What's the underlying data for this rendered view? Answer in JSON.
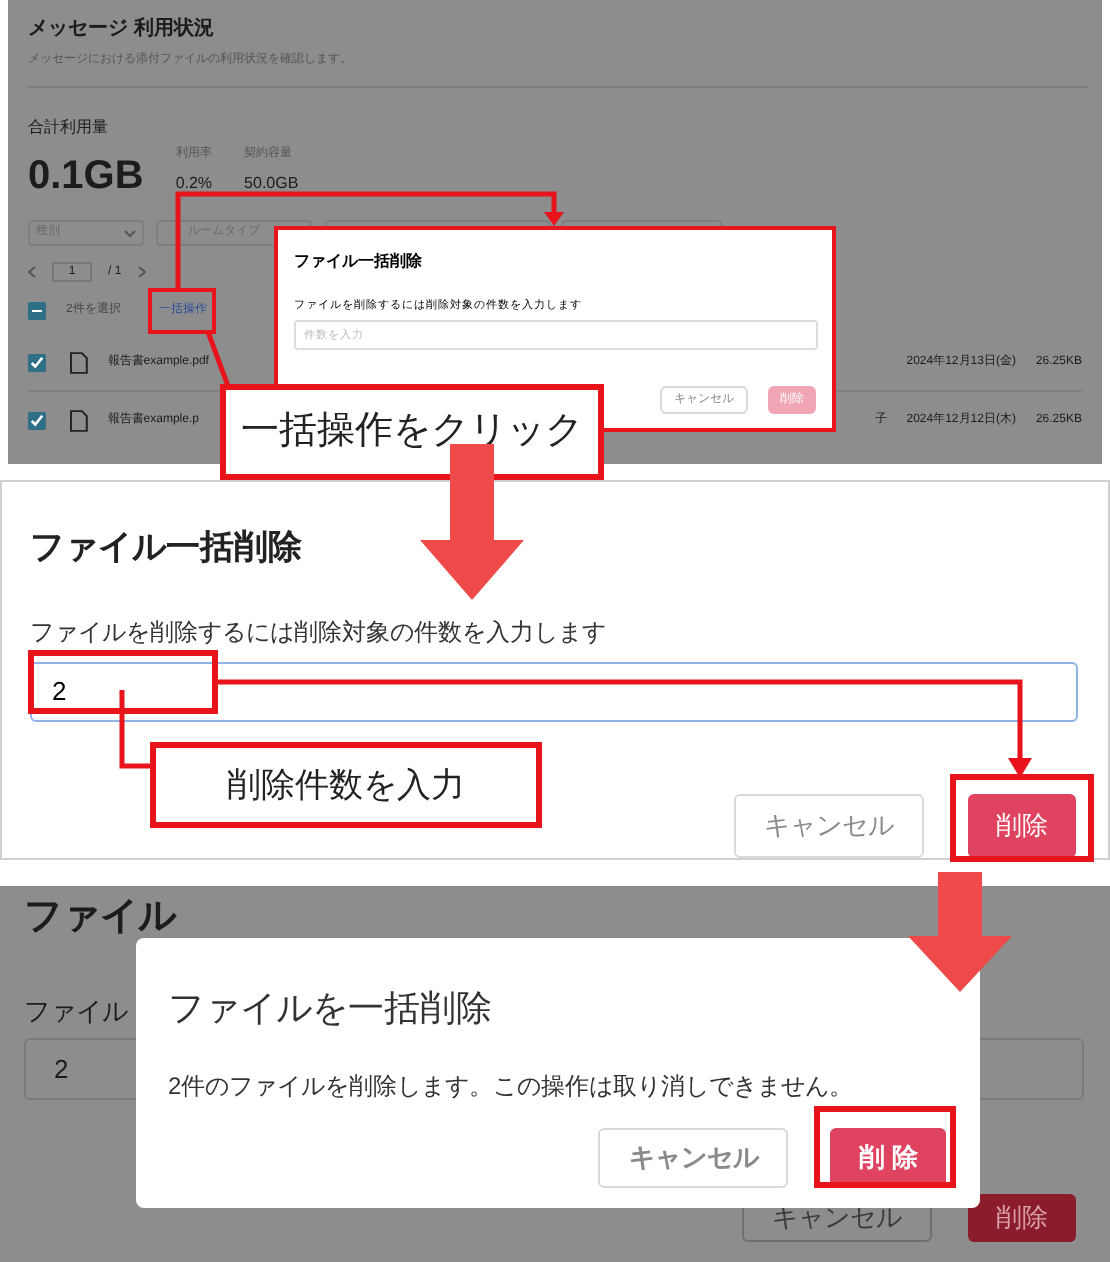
{
  "step1": {
    "page": {
      "title": "メッセージ 利用状況",
      "subtitle": "メッセージにおける添付ファイルの利用状況を確認します。",
      "total_label": "合計利用量",
      "total_value": "0.1GB",
      "stats": [
        {
          "label": "利用率",
          "value": "0.2%"
        },
        {
          "label": "契約容量",
          "value": "50.0GB"
        }
      ],
      "filters": [
        {
          "label": "種別"
        },
        {
          "label": "ルームタイプ"
        }
      ],
      "pagination": {
        "page": "1",
        "total": "/ 1"
      },
      "selection": {
        "indeterminate": true,
        "count": "2件を選択",
        "action": "一括操作"
      },
      "files": [
        {
          "name": "報告書example.pdf",
          "checked": true,
          "date": "2024年12月13日(金)",
          "size": "26.25KB"
        },
        {
          "name": "報告書example.p",
          "checked": true,
          "column_3": "子",
          "date": "2024年12月12日(木)",
          "size": "26.25KB"
        }
      ]
    },
    "dialog": {
      "title": "ファイル一括削除",
      "label": "ファイルを削除するには削除対象の件数を入力します",
      "placeholder": "件数を入力",
      "buttons": [
        {
          "label": "キャンセル",
          "kind": "secondary",
          "disabled": false
        },
        {
          "label": "削除",
          "kind": "danger",
          "disabled": true
        }
      ]
    },
    "callout": "一括操作をクリック"
  },
  "step2": {
    "dialog": {
      "title": "ファイル一括削除",
      "label": "ファイルを削除するには削除対象の件数を入力します",
      "value": "2",
      "buttons": [
        {
          "label": "キャンセル",
          "kind": "secondary",
          "disabled": false
        },
        {
          "label": "削除",
          "kind": "danger",
          "disabled": false
        }
      ]
    },
    "callout": "削除件数を入力"
  },
  "step3": {
    "background": {
      "title": "ファイル",
      "label": "ファイル",
      "value": "2",
      "buttons": [
        {
          "label": "キャンセル",
          "kind": "secondary",
          "disabled": false
        },
        {
          "label": "削除",
          "kind": "danger",
          "disabled": false
        }
      ]
    },
    "dialog": {
      "title": "ファイルを一括削除",
      "message": "2件のファイルを削除します。この操作は取り消しできません。",
      "buttons": [
        {
          "label": "キャンセル",
          "kind": "secondary",
          "disabled": false
        },
        {
          "label": "削 除",
          "kind": "danger",
          "disabled": false
        }
      ]
    }
  }
}
